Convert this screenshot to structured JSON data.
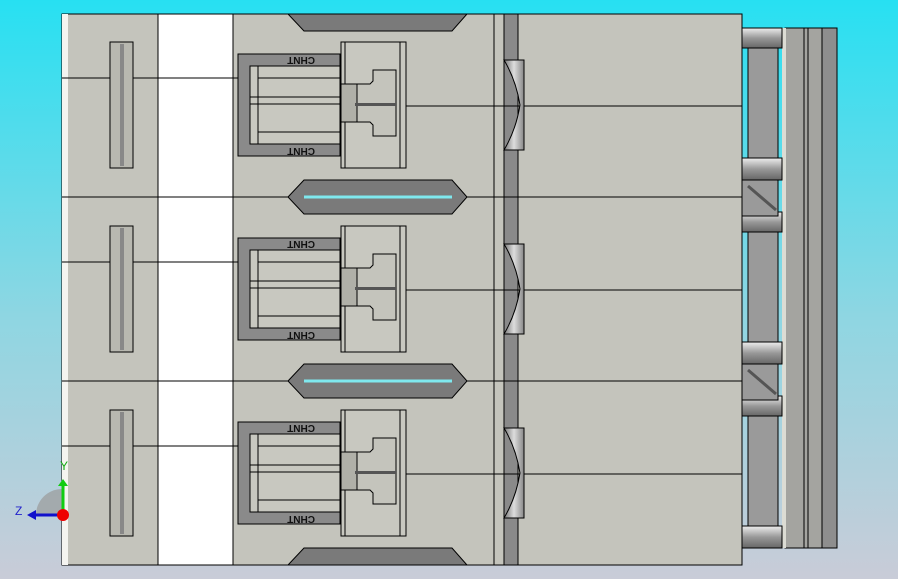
{
  "model": {
    "brand_marking": "CHNT",
    "pole_count": 3
  },
  "triad": {
    "y_label": "Y",
    "z_label": "Z"
  },
  "colors": {
    "body": "#c4c4bc",
    "accent_cyan": "#7fe8ee",
    "dark": "#6e6e6e"
  }
}
